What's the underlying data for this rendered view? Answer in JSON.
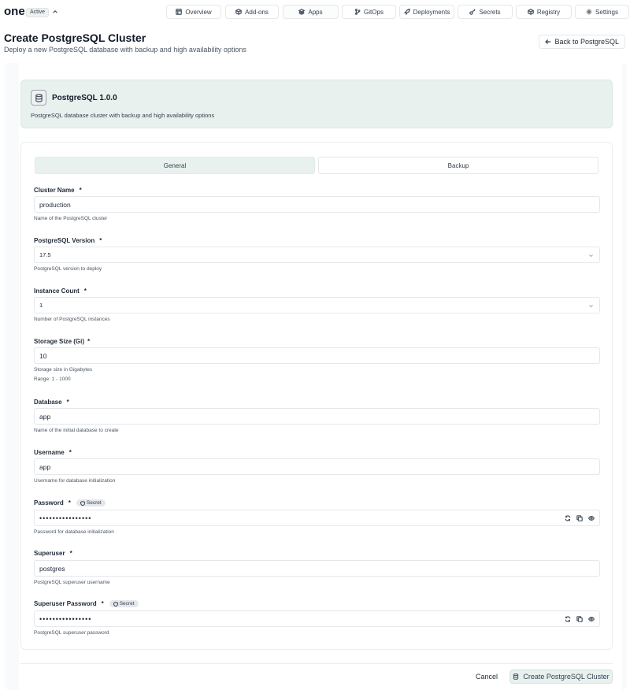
{
  "app": {
    "brand": "one",
    "status": "Active"
  },
  "nav": [
    {
      "key": "overview",
      "label": "Overview",
      "icon": "layout-icon"
    },
    {
      "key": "addons",
      "label": "Add-ons",
      "icon": "package-icon"
    },
    {
      "key": "apps",
      "label": "Apps",
      "icon": "layers-icon"
    },
    {
      "key": "gitops",
      "label": "GitOps",
      "icon": "git-branch-icon"
    },
    {
      "key": "deployments",
      "label": "Deployments",
      "icon": "rocket-icon"
    },
    {
      "key": "secrets",
      "label": "Secrets",
      "icon": "key-icon"
    },
    {
      "key": "registry",
      "label": "Registry",
      "icon": "box-icon"
    },
    {
      "key": "settings",
      "label": "Settings",
      "icon": "gear-icon"
    }
  ],
  "header": {
    "title": "Create PostgreSQL Cluster",
    "subtitle": "Deploy a new PostgreSQL database with backup and high availability options",
    "back_label": "Back to PostgreSQL"
  },
  "addon": {
    "title": "PostgreSQL 1.0.0",
    "description": "PostgreSQL database cluster with backup and high availability options"
  },
  "tabs": {
    "general": "General",
    "backup": "Backup"
  },
  "secret_label": "Secret",
  "fields": {
    "cluster_name": {
      "label": "Cluster Name",
      "required": "*",
      "value": "production",
      "help": "Name of the PostgreSQL cluster"
    },
    "pg_version": {
      "label": "PostgreSQL Version",
      "required": "*",
      "value": "17.5",
      "help": "PostgreSQL version to deploy"
    },
    "instance_count": {
      "label": "Instance Count",
      "required": "*",
      "value": "1",
      "help": "Number of PostgreSQL instances"
    },
    "storage_size": {
      "label": "Storage Size (Gi)",
      "required": "*",
      "value": "10",
      "help": "Storage size in Gigabytes",
      "range": "Range: 1 - 1000"
    },
    "database": {
      "label": "Database",
      "required": "*",
      "value": "app",
      "help": "Name of the initial database to create"
    },
    "username": {
      "label": "Username",
      "required": "*",
      "value": "app",
      "help": "Username for database initialization"
    },
    "password": {
      "label": "Password",
      "required": "*",
      "value": "••••••••••••••••",
      "help": "Password for database initialization"
    },
    "superuser": {
      "label": "Superuser",
      "required": "*",
      "value": "postgres",
      "help": "PostgreSQL superuser username"
    },
    "superuser_password": {
      "label": "Superuser Password",
      "required": "*",
      "value": "••••••••••••••••",
      "help": "PostgreSQL superuser password"
    }
  },
  "footer": {
    "cancel": "Cancel",
    "create": "Create PostgreSQL Cluster"
  }
}
